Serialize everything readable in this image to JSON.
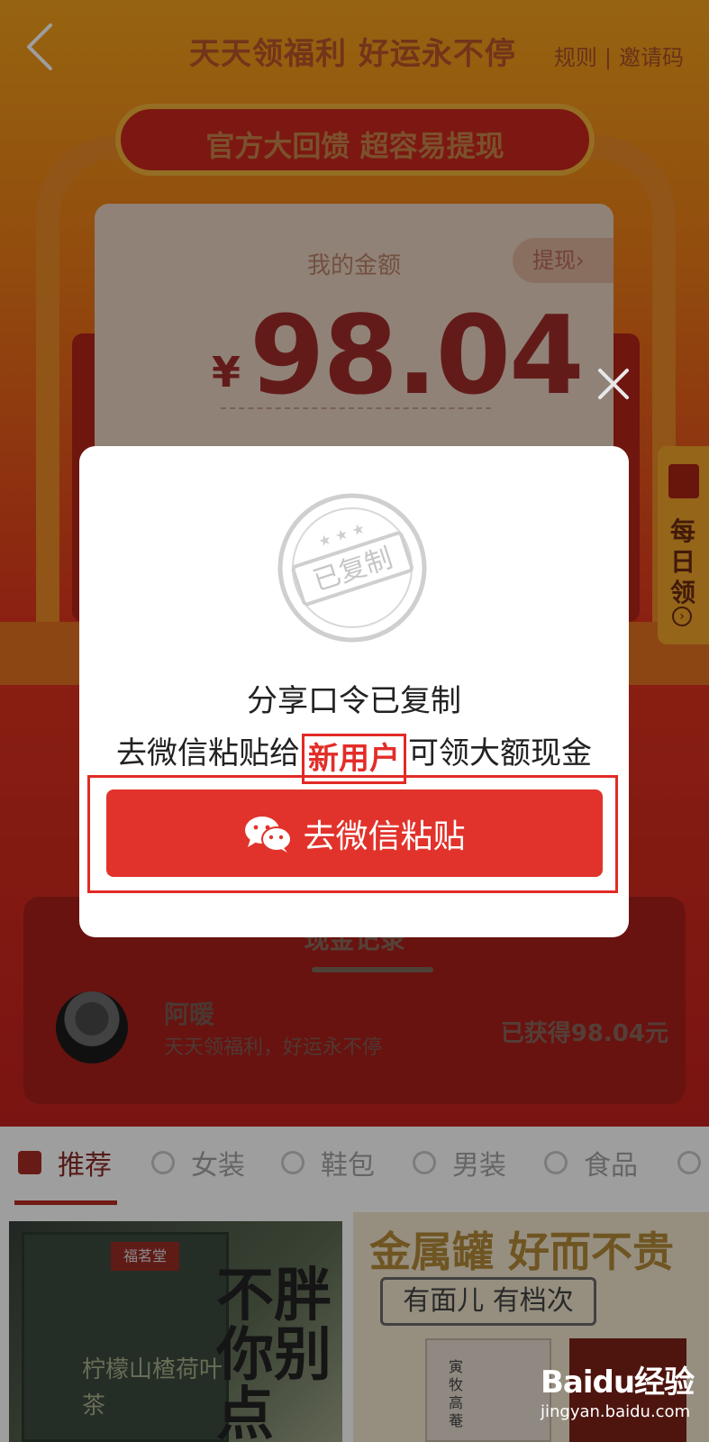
{
  "header": {
    "title": "天天领福利 好运永不停",
    "rules_link": "规则",
    "separator": "|",
    "invite_link": "邀请码"
  },
  "banner": {
    "text": "官方大回馈 超容易提现"
  },
  "balance": {
    "label": "我的金额",
    "withdraw_label": "提现",
    "currency": "¥",
    "amount": "98.04"
  },
  "daily_tab": {
    "label": "每日领"
  },
  "records": {
    "title": "现金记录",
    "items": [
      {
        "name": "阿暖",
        "subtitle": "天天领福利，好运永不停",
        "gain": "已获得98.04元"
      }
    ]
  },
  "categories": {
    "tabs": [
      {
        "label": "推荐",
        "active": true
      },
      {
        "label": "女装",
        "active": false
      },
      {
        "label": "鞋包",
        "active": false
      },
      {
        "label": "男装",
        "active": false
      },
      {
        "label": "食品",
        "active": false
      }
    ]
  },
  "promos": {
    "left_tag": "福茗堂",
    "left_text": "柠檬山楂荷叶茶",
    "left_big": "不胖你别点",
    "right_title": "金属罐 好而不贵",
    "right_sub": "有面儿 有档次",
    "right_box_text": "寅牧高菴"
  },
  "dialog": {
    "stamp_text": "已复制",
    "line1": "分享口令已复制",
    "line2_prefix": "去微信粘贴给",
    "line2_highlight": "新用户",
    "line2_suffix": "可领大额现金",
    "button_label": "去微信粘贴",
    "button_icon": "wechat-icon",
    "close_icon": "close-icon"
  },
  "colors": {
    "primary_red": "#e1332b",
    "highlight_red": "#e22d2a",
    "overlay": "rgba(0,0,0,0.38)"
  },
  "watermark": {
    "logo": "Baidu经验",
    "url": "jingyan.baidu.com"
  }
}
